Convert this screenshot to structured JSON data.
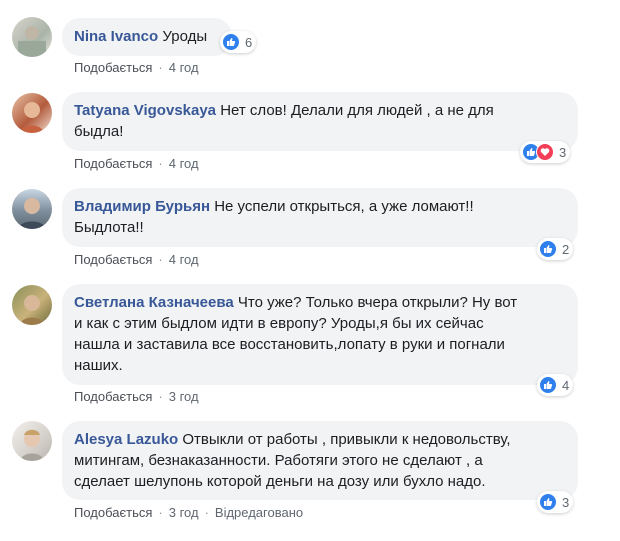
{
  "colors": {
    "author": "#385898",
    "bubble": "#f2f3f5",
    "like": "#2f80ed",
    "love": "#f33e58"
  },
  "comments": [
    {
      "author": "Nina Ivanco",
      "text": "Уроды",
      "like_label": "Подобається",
      "time": "4 год",
      "reactions": [
        "like-icon"
      ],
      "reaction_count": "6"
    },
    {
      "author": "Tatyana Vigovskaya",
      "text_line1": "Нет слов! Делали для людей , а не для",
      "text_line2": "быдла!",
      "like_label": "Подобається",
      "time": "4 год",
      "reactions": [
        "like-icon",
        "love-icon"
      ],
      "reaction_count": "3"
    },
    {
      "author": "Владимир Бурьян",
      "text_line1": "Не успели открыться, а уже ломают!!",
      "text_line2": "Быдлота!!",
      "like_label": "Подобається",
      "time": "4 год",
      "reactions": [
        "like-icon"
      ],
      "reaction_count": "2"
    },
    {
      "author": "Светлана Казначеева",
      "text_line1": "Что уже? Только вчера открыли? Ну вот",
      "text_line2": "и как с этим быдлом идти в европу? Уроды,я бы их сейчас",
      "text_line3": "нашла и заставила все восстановить,лопату в руки и погнали",
      "text_line4": "наших.",
      "like_label": "Подобається",
      "time": "3 год",
      "reactions": [
        "like-icon"
      ],
      "reaction_count": "4"
    },
    {
      "author": "Alesya Lazuko",
      "text_line1": "Отвыкли от работы , привыкли к недовольству,",
      "text_line2": "митингам, безнаказанности. Работяги этого не сделают , а",
      "text_line3": "сделает шелупонь которой деньги на дозу или бухло надо.",
      "like_label": "Подобається",
      "time": "3 год",
      "edited": "Відредаговано",
      "reactions": [
        "like-icon"
      ],
      "reaction_count": "3"
    }
  ]
}
